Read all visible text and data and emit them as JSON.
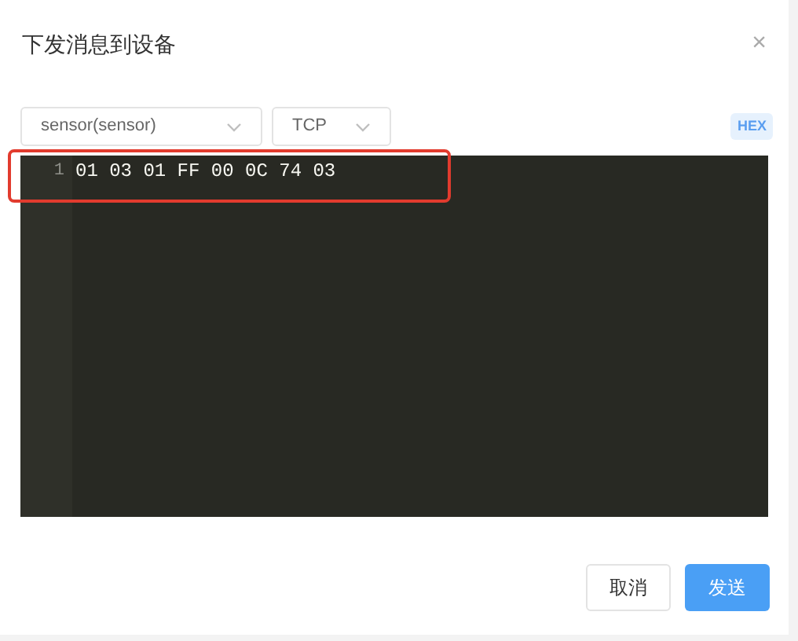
{
  "dialog": {
    "title": "下发消息到设备",
    "close": "×"
  },
  "selects": [
    {
      "value": "sensor(sensor)"
    },
    {
      "value": "TCP"
    }
  ],
  "hex_badge": "HEX",
  "editor": {
    "lines": [
      {
        "number": "1",
        "text": "01 03 01 FF 00 0C 74 03",
        "highlighted": true
      }
    ]
  },
  "buttons": [
    {
      "label": "取消",
      "kind": "default"
    },
    {
      "label": "发送",
      "kind": "primary"
    }
  ]
}
